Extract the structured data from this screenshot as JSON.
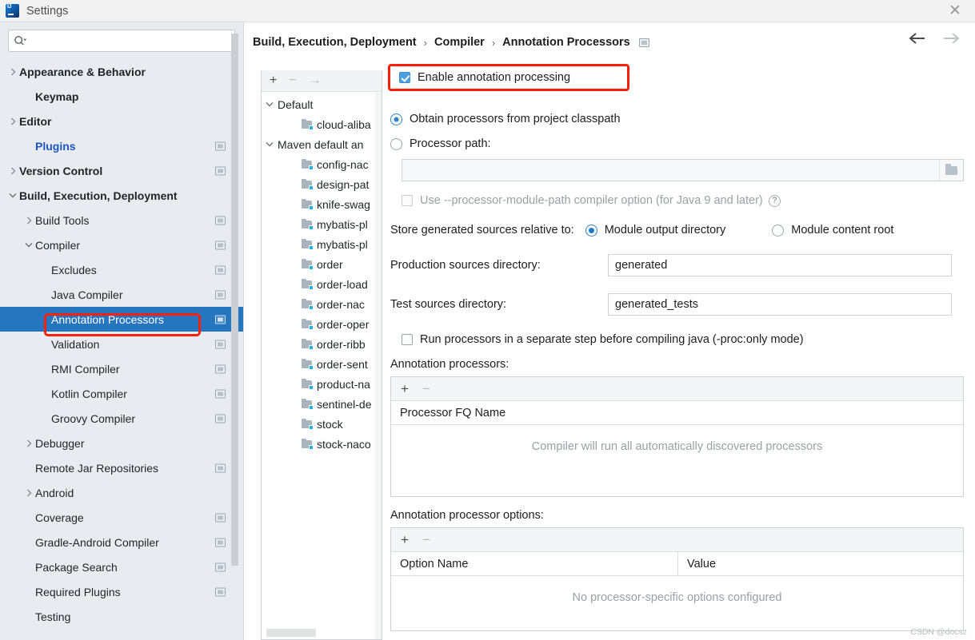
{
  "window": {
    "title": "Settings",
    "logo_icon": "intellij-idea-logo",
    "close_icon": "close-icon"
  },
  "sidebar": {
    "search": {
      "placeholder": "",
      "value": "",
      "icon": "search-icon"
    },
    "items": [
      {
        "label": "Appearance & Behavior",
        "arrow": "right",
        "bold": true,
        "badge": false,
        "indent": 0
      },
      {
        "label": "Keymap",
        "arrow": "none",
        "bold": true,
        "badge": false,
        "indent": 1
      },
      {
        "label": "Editor",
        "arrow": "right",
        "bold": true,
        "badge": false,
        "indent": 0
      },
      {
        "label": "Plugins",
        "arrow": "none",
        "bold": true,
        "badge": true,
        "indent": 1,
        "style": "plugins"
      },
      {
        "label": "Version Control",
        "arrow": "right",
        "bold": true,
        "badge": true,
        "indent": 0
      },
      {
        "label": "Build, Execution, Deployment",
        "arrow": "down",
        "bold": true,
        "badge": false,
        "indent": 0
      },
      {
        "label": "Build Tools",
        "arrow": "right",
        "bold": false,
        "badge": true,
        "indent": 1
      },
      {
        "label": "Compiler",
        "arrow": "down",
        "bold": false,
        "badge": true,
        "indent": 1
      },
      {
        "label": "Excludes",
        "arrow": "none",
        "bold": false,
        "badge": true,
        "indent": 2
      },
      {
        "label": "Java Compiler",
        "arrow": "none",
        "bold": false,
        "badge": true,
        "indent": 2
      },
      {
        "label": "Annotation Processors",
        "arrow": "none",
        "bold": false,
        "badge": true,
        "indent": 2,
        "selected": true
      },
      {
        "label": "Validation",
        "arrow": "none",
        "bold": false,
        "badge": true,
        "indent": 2
      },
      {
        "label": "RMI Compiler",
        "arrow": "none",
        "bold": false,
        "badge": true,
        "indent": 2
      },
      {
        "label": "Kotlin Compiler",
        "arrow": "none",
        "bold": false,
        "badge": true,
        "indent": 2
      },
      {
        "label": "Groovy Compiler",
        "arrow": "none",
        "bold": false,
        "badge": true,
        "indent": 2
      },
      {
        "label": "Debugger",
        "arrow": "right",
        "bold": false,
        "badge": false,
        "indent": 1
      },
      {
        "label": "Remote Jar Repositories",
        "arrow": "none",
        "bold": false,
        "badge": true,
        "indent": 1
      },
      {
        "label": "Android",
        "arrow": "right",
        "bold": false,
        "badge": false,
        "indent": 1
      },
      {
        "label": "Coverage",
        "arrow": "none",
        "bold": false,
        "badge": true,
        "indent": 1
      },
      {
        "label": "Gradle-Android Compiler",
        "arrow": "none",
        "bold": false,
        "badge": true,
        "indent": 1
      },
      {
        "label": "Package Search",
        "arrow": "none",
        "bold": false,
        "badge": true,
        "indent": 1
      },
      {
        "label": "Required Plugins",
        "arrow": "none",
        "bold": false,
        "badge": true,
        "indent": 1
      },
      {
        "label": "Testing",
        "arrow": "none",
        "bold": false,
        "badge": false,
        "indent": 1
      }
    ]
  },
  "module_panel": {
    "toolbar": {
      "add": "+",
      "remove": "−",
      "move": "→"
    },
    "rows": [
      {
        "label": "Default",
        "type": "group",
        "arrow": "down"
      },
      {
        "label": "cloud-aliba",
        "type": "module"
      },
      {
        "label": "Maven default an",
        "type": "group",
        "arrow": "down"
      },
      {
        "label": "config-nac",
        "type": "module"
      },
      {
        "label": "design-pat",
        "type": "module"
      },
      {
        "label": "knife-swag",
        "type": "module"
      },
      {
        "label": "mybatis-pl",
        "type": "module"
      },
      {
        "label": "mybatis-pl",
        "type": "module"
      },
      {
        "label": "order",
        "type": "module"
      },
      {
        "label": "order-load",
        "type": "module"
      },
      {
        "label": "order-nac",
        "type": "module"
      },
      {
        "label": "order-oper",
        "type": "module"
      },
      {
        "label": "order-ribb",
        "type": "module"
      },
      {
        "label": "order-sent",
        "type": "module"
      },
      {
        "label": "product-na",
        "type": "module"
      },
      {
        "label": "sentinel-de",
        "type": "module"
      },
      {
        "label": "stock",
        "type": "module"
      },
      {
        "label": "stock-naco",
        "type": "module"
      }
    ]
  },
  "header": {
    "breadcrumb": [
      "Build, Execution, Deployment",
      "Compiler",
      "Annotation Processors"
    ],
    "separator": "›",
    "project_badge_icon": "project-scope-icon",
    "back_icon": "arrow-left-icon",
    "forward_icon": "arrow-right-icon"
  },
  "main": {
    "enable_annotation_processing": {
      "label": "Enable annotation processing",
      "checked": true
    },
    "source_mode": {
      "from_classpath": {
        "label": "Obtain processors from project classpath",
        "selected": true
      },
      "processor_path": {
        "label": "Processor path:",
        "selected": false
      },
      "path_value": "",
      "browse_icon": "folder-icon"
    },
    "module_path_option": {
      "label": "Use --processor-module-path compiler option (for Java 9 and later)",
      "checked": false,
      "disabled": true,
      "help_icon": "help-icon"
    },
    "store_relative": {
      "label": "Store generated sources relative to:",
      "options": [
        "Module output directory",
        "Module content root"
      ],
      "selected_index": 0
    },
    "production_sources": {
      "label": "Production sources directory:",
      "value": "generated"
    },
    "test_sources": {
      "label": "Test sources directory:",
      "value": "generated_tests"
    },
    "separate_step": {
      "label": "Run processors in a separate step before compiling java (-proc:only mode)",
      "checked": false
    },
    "processors_table": {
      "caption": "Annotation processors:",
      "toolbar": {
        "add": "+",
        "remove": "−"
      },
      "columns": [
        "Processor FQ Name"
      ],
      "rows": [],
      "empty_text": "Compiler will run all automatically discovered processors"
    },
    "options_table": {
      "caption": "Annotation processor options:",
      "toolbar": {
        "add": "+",
        "remove": "−"
      },
      "columns": [
        "Option Name",
        "Value"
      ],
      "rows": [],
      "empty_text": "No processor-specific options configured"
    }
  },
  "watermark": "CSDN @docsz",
  "colors": {
    "accent_blue": "#2675bf",
    "highlight_red": "#fa1f09",
    "checkbox_blue": "#4d9fe0",
    "radio_blue": "#2d82c8",
    "sidebar_bg": "#e8ecf0",
    "link_blue": "#1a56c4"
  }
}
